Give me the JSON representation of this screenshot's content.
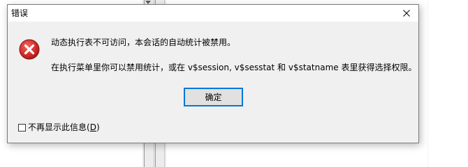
{
  "dialog": {
    "title": "错误",
    "message_line1": "动态执行表不可访问，本会话的自动统计被禁用。",
    "message_line2": "在执行菜单里你可以禁用统计，或在 v$session, v$sesstat 和 v$statname 表里获得选择权限。",
    "ok_label": "确定",
    "checkbox_label_prefix": "不再显示此信息(",
    "checkbox_label_mnemonic": "D",
    "checkbox_label_suffix": ")",
    "checkbox_checked": false
  },
  "icons": {
    "close": "close-icon",
    "error": "error-icon"
  },
  "colors": {
    "error_red": "#d32f2f",
    "focus_blue": "#0078d7",
    "dialog_bg": "#f0f0f0"
  }
}
